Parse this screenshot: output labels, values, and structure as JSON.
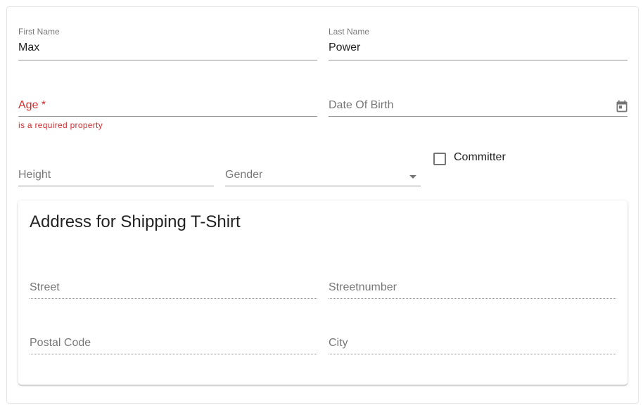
{
  "form": {
    "first_name": {
      "label": "First Name",
      "value": "Max"
    },
    "last_name": {
      "label": "Last Name",
      "value": "Power"
    },
    "age": {
      "label": "Age *",
      "error": "is a required property"
    },
    "date_of_birth": {
      "label": "Date Of Birth",
      "icon": "calendar-icon"
    },
    "height": {
      "label": "Height"
    },
    "gender": {
      "label": "Gender",
      "icon": "dropdown-arrow-icon"
    },
    "committer": {
      "label": "Committer",
      "checked": false
    }
  },
  "address": {
    "title": "Address for Shipping T-Shirt",
    "street": {
      "label": "Street"
    },
    "streetnumber": {
      "label": "Streetnumber"
    },
    "postal_code": {
      "label": "Postal Code"
    },
    "city": {
      "label": "City"
    }
  },
  "colors": {
    "error": "#d32f2f",
    "text": "#212121",
    "muted": "#757575"
  }
}
